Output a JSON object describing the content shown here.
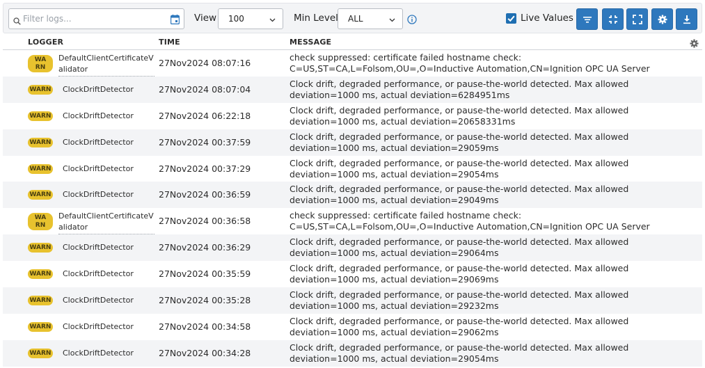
{
  "toolbar": {
    "filter_placeholder": "Filter logs...",
    "view_label": "View",
    "view_value": "100",
    "min_level_label": "Min Level",
    "min_level_value": "ALL",
    "live_values_label": "Live Values",
    "live_values_checked": true,
    "accent_color": "#2e78bd"
  },
  "columns": {
    "logger": "LOGGER",
    "time": "TIME",
    "message": "MESSAGE"
  },
  "rows": [
    {
      "level": "WARN",
      "logger": "DefaultClientCertificateValidator",
      "time": "27Nov2024 08:07:16",
      "message": "check suppressed: certificate failed hostname check: C=US,ST=CA,L=Folsom,OU=,O=Inductive Automation,CN=Ignition OPC UA Server"
    },
    {
      "level": "WARN",
      "logger": "ClockDriftDetector",
      "time": "27Nov2024 08:07:04",
      "message": "Clock drift, degraded performance, or pause-the-world detected. Max allowed deviation=1000 ms, actual deviation=6284951ms"
    },
    {
      "level": "WARN",
      "logger": "ClockDriftDetector",
      "time": "27Nov2024 06:22:18",
      "message": "Clock drift, degraded performance, or pause-the-world detected. Max allowed deviation=1000 ms, actual deviation=20658331ms"
    },
    {
      "level": "WARN",
      "logger": "ClockDriftDetector",
      "time": "27Nov2024 00:37:59",
      "message": "Clock drift, degraded performance, or pause-the-world detected. Max allowed deviation=1000 ms, actual deviation=29059ms"
    },
    {
      "level": "WARN",
      "logger": "ClockDriftDetector",
      "time": "27Nov2024 00:37:29",
      "message": "Clock drift, degraded performance, or pause-the-world detected. Max allowed deviation=1000 ms, actual deviation=29054ms"
    },
    {
      "level": "WARN",
      "logger": "ClockDriftDetector",
      "time": "27Nov2024 00:36:59",
      "message": "Clock drift, degraded performance, or pause-the-world detected. Max allowed deviation=1000 ms, actual deviation=29049ms"
    },
    {
      "level": "WARN",
      "logger": "DefaultClientCertificateValidator",
      "time": "27Nov2024 00:36:58",
      "message": "check suppressed: certificate failed hostname check: C=US,ST=CA,L=Folsom,OU=,O=Inductive Automation,CN=Ignition OPC UA Server"
    },
    {
      "level": "WARN",
      "logger": "ClockDriftDetector",
      "time": "27Nov2024 00:36:29",
      "message": "Clock drift, degraded performance, or pause-the-world detected. Max allowed deviation=1000 ms, actual deviation=29064ms"
    },
    {
      "level": "WARN",
      "logger": "ClockDriftDetector",
      "time": "27Nov2024 00:35:59",
      "message": "Clock drift, degraded performance, or pause-the-world detected. Max allowed deviation=1000 ms, actual deviation=29069ms"
    },
    {
      "level": "WARN",
      "logger": "ClockDriftDetector",
      "time": "27Nov2024 00:35:28",
      "message": "Clock drift, degraded performance, or pause-the-world detected. Max allowed deviation=1000 ms, actual deviation=29232ms"
    },
    {
      "level": "WARN",
      "logger": "ClockDriftDetector",
      "time": "27Nov2024 00:34:58",
      "message": "Clock drift, degraded performance, or pause-the-world detected. Max allowed deviation=1000 ms, actual deviation=29062ms"
    },
    {
      "level": "WARN",
      "logger": "ClockDriftDetector",
      "time": "27Nov2024 00:34:28",
      "message": "Clock drift, degraded performance, or pause-the-world detected. Max allowed deviation=1000 ms, actual deviation=29054ms"
    }
  ],
  "icons": {
    "filter_search": "search-icon",
    "calendar": "calendar-icon",
    "info": "info-icon",
    "filter_button": "filter-icon",
    "collapse_button": "collapse-icon",
    "fullscreen_button": "fullscreen-icon",
    "settings_button": "gear-icon",
    "download_button": "download-icon",
    "column_settings": "gear-icon"
  },
  "colors": {
    "warn_badge": "#e8c22e",
    "row_alt": "#f3f4f6"
  }
}
